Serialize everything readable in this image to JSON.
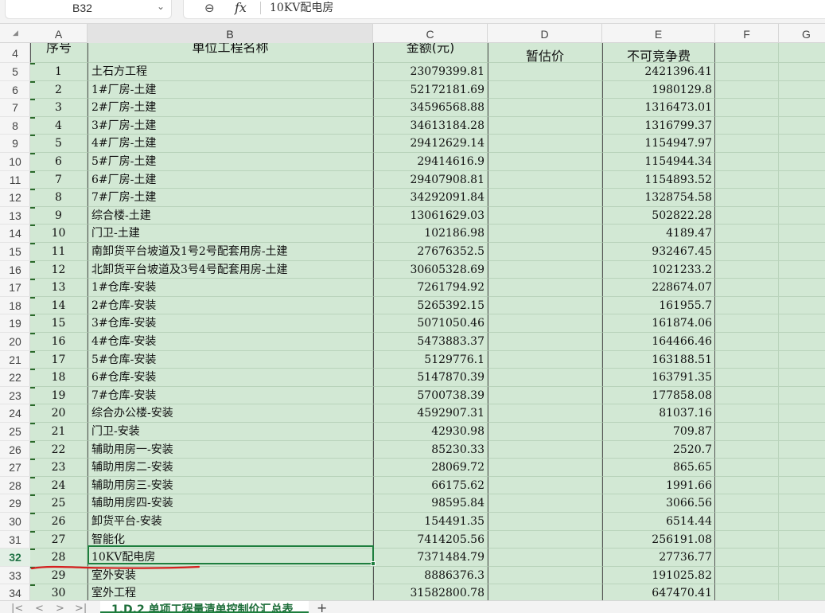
{
  "formula_bar": {
    "name_box": "B32",
    "zoom_icon": "zoom-out-icon",
    "fx_label": "fx",
    "formula_value": "10KV配电房"
  },
  "columns": [
    "A",
    "B",
    "C",
    "D",
    "E",
    "F",
    "G"
  ],
  "selected_column": "B",
  "header_row": {
    "row_number": "4",
    "cells": [
      "序号",
      "单位工程名称",
      "金额(元)",
      "暂估价",
      "不可竞争费"
    ]
  },
  "rows": [
    {
      "rn": "5",
      "seq": "1",
      "name": "土石方工程",
      "amount": "23079399.81",
      "noncomp": "2421396.41"
    },
    {
      "rn": "6",
      "seq": "2",
      "name": "1#厂房-土建",
      "amount": "52172181.69",
      "noncomp": "1980129.8"
    },
    {
      "rn": "7",
      "seq": "3",
      "name": "2#厂房-土建",
      "amount": "34596568.88",
      "noncomp": "1316473.01"
    },
    {
      "rn": "8",
      "seq": "4",
      "name": "3#厂房-土建",
      "amount": "34613184.28",
      "noncomp": "1316799.37"
    },
    {
      "rn": "9",
      "seq": "5",
      "name": "4#厂房-土建",
      "amount": "29412629.14",
      "noncomp": "1154947.97"
    },
    {
      "rn": "10",
      "seq": "6",
      "name": "5#厂房-土建",
      "amount": "29414616.9",
      "noncomp": "1154944.34"
    },
    {
      "rn": "11",
      "seq": "7",
      "name": "6#厂房-土建",
      "amount": "29407908.81",
      "noncomp": "1154893.52"
    },
    {
      "rn": "12",
      "seq": "8",
      "name": "7#厂房-土建",
      "amount": "34292091.84",
      "noncomp": "1328754.58"
    },
    {
      "rn": "13",
      "seq": "9",
      "name": "综合楼-土建",
      "amount": "13061629.03",
      "noncomp": "502822.28"
    },
    {
      "rn": "14",
      "seq": "10",
      "name": "门卫-土建",
      "amount": "102186.98",
      "noncomp": "4189.47"
    },
    {
      "rn": "15",
      "seq": "11",
      "name": "南卸货平台坡道及1号2号配套用房-土建",
      "amount": "27676352.5",
      "noncomp": "932467.45"
    },
    {
      "rn": "16",
      "seq": "12",
      "name": "北卸货平台坡道及3号4号配套用房-土建",
      "amount": "30605328.69",
      "noncomp": "1021233.2"
    },
    {
      "rn": "17",
      "seq": "13",
      "name": "1#仓库-安装",
      "amount": "7261794.92",
      "noncomp": "228674.07"
    },
    {
      "rn": "18",
      "seq": "14",
      "name": "2#仓库-安装",
      "amount": "5265392.15",
      "noncomp": "161955.7"
    },
    {
      "rn": "19",
      "seq": "15",
      "name": "3#仓库-安装",
      "amount": "5071050.46",
      "noncomp": "161874.06"
    },
    {
      "rn": "20",
      "seq": "16",
      "name": "4#仓库-安装",
      "amount": "5473883.37",
      "noncomp": "164466.46"
    },
    {
      "rn": "21",
      "seq": "17",
      "name": "5#仓库-安装",
      "amount": "5129776.1",
      "noncomp": "163188.51"
    },
    {
      "rn": "22",
      "seq": "18",
      "name": "6#仓库-安装",
      "amount": "5147870.39",
      "noncomp": "163791.35"
    },
    {
      "rn": "23",
      "seq": "19",
      "name": "7#仓库-安装",
      "amount": "5700738.39",
      "noncomp": "177858.08"
    },
    {
      "rn": "24",
      "seq": "20",
      "name": "综合办公楼-安装",
      "amount": "4592907.31",
      "noncomp": "81037.16"
    },
    {
      "rn": "25",
      "seq": "21",
      "name": "门卫-安装",
      "amount": "42930.98",
      "noncomp": "709.87"
    },
    {
      "rn": "26",
      "seq": "22",
      "name": "辅助用房一-安装",
      "amount": "85230.33",
      "noncomp": "2520.7"
    },
    {
      "rn": "27",
      "seq": "23",
      "name": "辅助用房二-安装",
      "amount": "28069.72",
      "noncomp": "865.65"
    },
    {
      "rn": "28",
      "seq": "24",
      "name": "辅助用房三-安装",
      "amount": "66175.62",
      "noncomp": "1991.66"
    },
    {
      "rn": "29",
      "seq": "25",
      "name": "辅助用房四-安装",
      "amount": "98595.84",
      "noncomp": "3066.56"
    },
    {
      "rn": "30",
      "seq": "26",
      "name": "卸货平台-安装",
      "amount": "154491.35",
      "noncomp": "6514.44"
    },
    {
      "rn": "31",
      "seq": "27",
      "name": "智能化",
      "amount": "7414205.56",
      "noncomp": "256191.08"
    },
    {
      "rn": "32",
      "seq": "28",
      "name": "10KV配电房",
      "amount": "7371484.79",
      "noncomp": "27736.77"
    },
    {
      "rn": "33",
      "seq": "29",
      "name": "室外安装",
      "amount": "8886376.3",
      "noncomp": "191025.82"
    },
    {
      "rn": "34",
      "seq": "30",
      "name": "室外工程",
      "amount": "31582800.78",
      "noncomp": "647470.41"
    }
  ],
  "selected_row": "32",
  "sheet_tabs": {
    "active": "1.D.2 单项工程量清单控制价汇总表",
    "nav_icons": [
      "first-sheet-icon",
      "prev-sheet-icon",
      "next-sheet-icon",
      "last-sheet-icon"
    ]
  },
  "colors": {
    "grid_fill": "#d2e8d4",
    "selection": "#1e7e3e",
    "annotation": "#d62020"
  }
}
